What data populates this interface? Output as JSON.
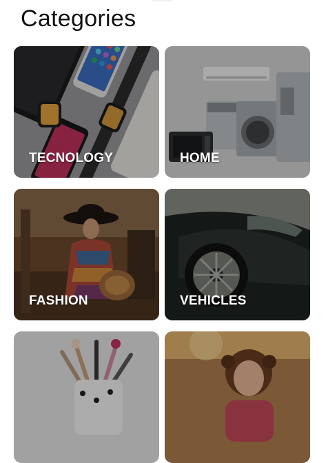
{
  "page": {
    "title": "Categories"
  },
  "categories": [
    {
      "label": "TECNOLOGY",
      "image": "phones-and-smartwatch-photo"
    },
    {
      "label": "HOME",
      "image": "home-appliances-photo"
    },
    {
      "label": "FASHION",
      "image": "fashion-model-photo"
    },
    {
      "label": "VEHICLES",
      "image": "sports-car-photo"
    },
    {
      "label": "",
      "image": "makeup-brushes-photo"
    },
    {
      "label": "",
      "image": "child-portrait-photo"
    }
  ]
}
